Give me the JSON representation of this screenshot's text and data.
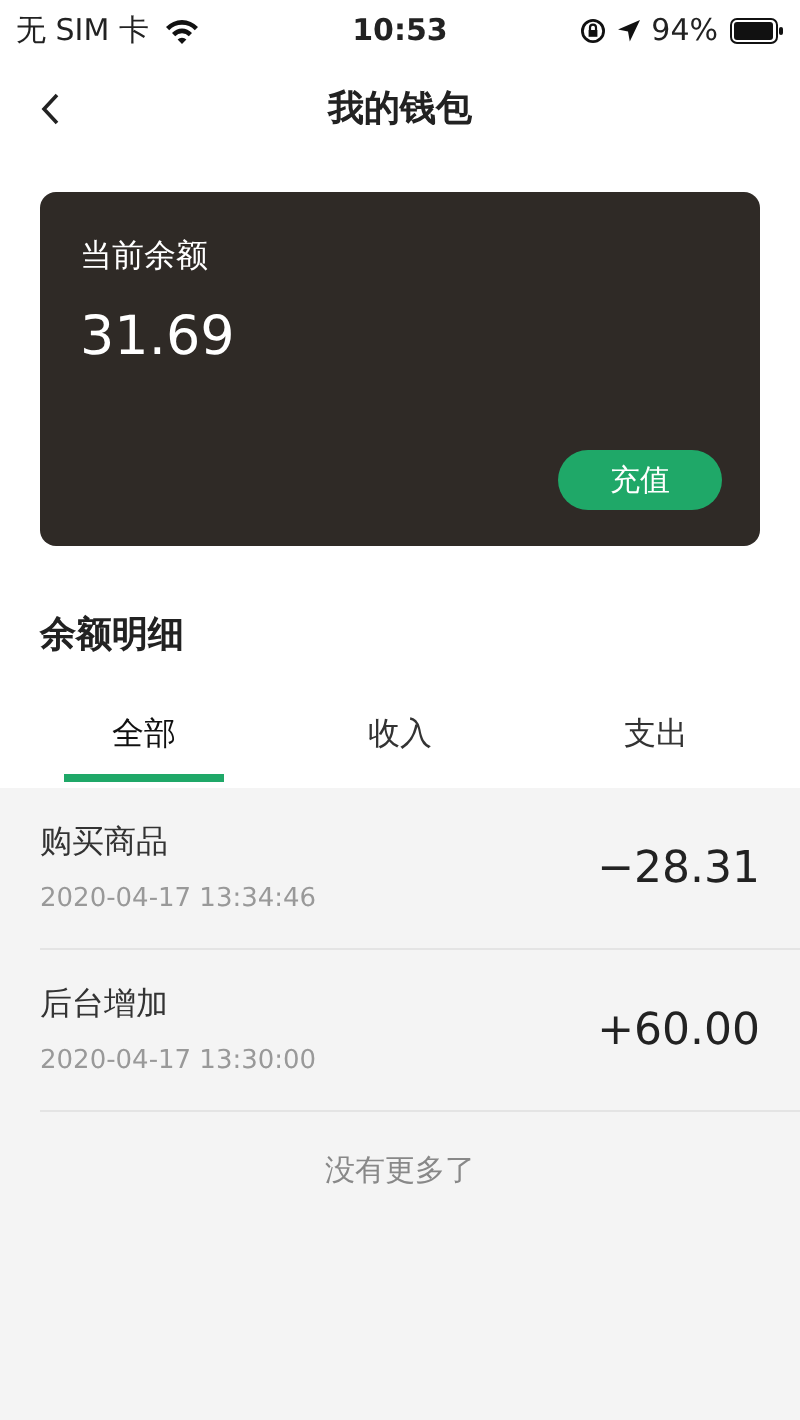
{
  "status_bar": {
    "carrier": "无 SIM 卡",
    "time": "10:53",
    "battery": "94%"
  },
  "nav": {
    "title": "我的钱包"
  },
  "balance_card": {
    "label": "当前余额",
    "amount": "31.69",
    "button": "充值"
  },
  "section_title": "余额明细",
  "tabs": [
    {
      "label": "全部",
      "selected": true
    },
    {
      "label": "收入",
      "selected": false
    },
    {
      "label": "支出",
      "selected": false
    }
  ],
  "transactions": [
    {
      "title": "购买商品",
      "time": "2020-04-17 13:34:46",
      "amount": "−28.31"
    },
    {
      "title": "后台增加",
      "time": "2020-04-17 13:30:00",
      "amount": "+60.00"
    }
  ],
  "footer": "没有更多了"
}
